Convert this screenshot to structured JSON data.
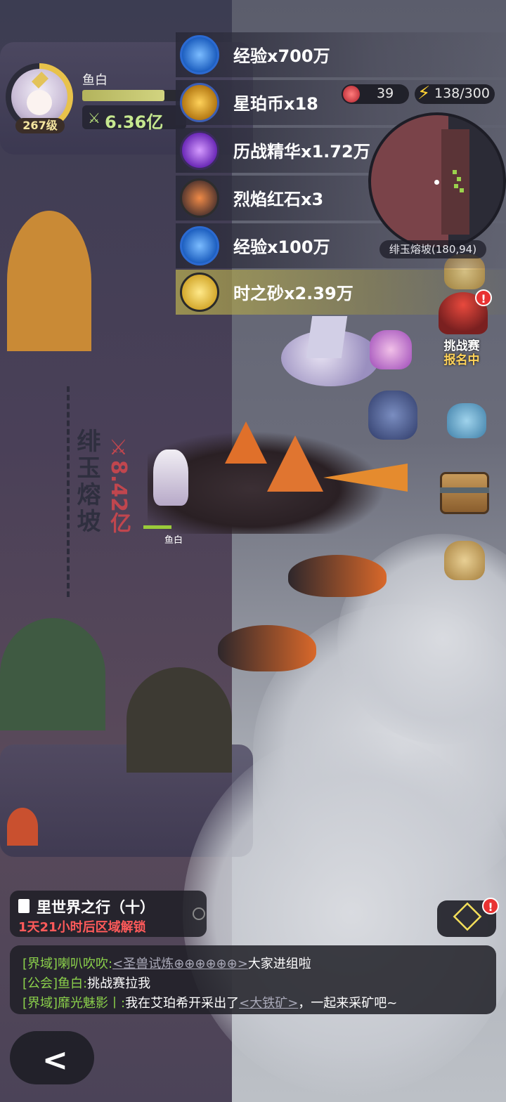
{
  "player": {
    "name": "鱼白",
    "level": "267级",
    "power": "6.36亿",
    "power_icon": "swords-icon",
    "exp_progress": 0.78
  },
  "rewards": [
    {
      "label": "经验x700万",
      "icon": "exp-orb-icon"
    },
    {
      "label": "星珀币x18",
      "icon": "star-coin-icon"
    },
    {
      "label": "历战精华x1.72万",
      "icon": "battle-essence-icon"
    },
    {
      "label": "烈焰红石x3",
      "icon": "flame-redstone-icon"
    },
    {
      "label": "经验x100万",
      "icon": "exp-orb-icon"
    },
    {
      "label": "时之砂x2.39万",
      "icon": "time-sand-icon"
    }
  ],
  "resources": {
    "apples": "39",
    "energy": "138/300"
  },
  "minimap": {
    "location": "绯玉熔坡(180,94)"
  },
  "zone": {
    "name": "绯玉熔坡",
    "power": "8.42亿"
  },
  "hero_label": "鱼白",
  "challenge": {
    "title": "挑战赛",
    "status": "报名中",
    "alert": "!"
  },
  "quest": {
    "title": "里世界之行（十）",
    "subtitle": "1天21小时后区域解锁"
  },
  "cube_alert": "!",
  "chat": [
    {
      "channel": "[界域]",
      "user": "喇叭吹吹:",
      "link": "<圣兽试炼⊕⊕⊕⊕⊕⊕>",
      "text": "大家进组啦"
    },
    {
      "channel": "[公会]",
      "user": "鱼白:",
      "link": "",
      "text": "挑战赛拉我"
    },
    {
      "channel": "[界域]",
      "user": "靡光魅影丨:",
      "text": "我在艾珀希开采出了",
      "link": "<大铁矿>",
      "text2": "，一起来采矿吧~"
    }
  ],
  "colors": {
    "power_text": "#c6e88f",
    "zone_power": "#c0464e",
    "chat_channel": "#8bd14b",
    "alert": "#e83232"
  }
}
